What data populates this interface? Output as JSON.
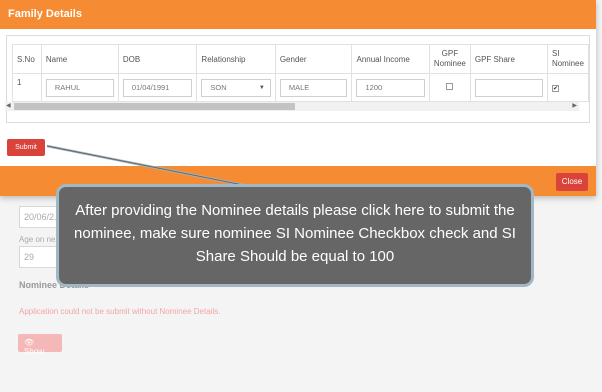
{
  "background": {
    "date_value": "20/06/2...",
    "age_label": "Age on ne...",
    "age_value": "29",
    "nominee_heading": "Nominee Details",
    "error_text": "Application could not be submit without Nominee Details.",
    "show_button": "Show"
  },
  "modal": {
    "title": "Family Details",
    "columns": [
      "S.No",
      "Name",
      "DOB",
      "Relationship",
      "Gender",
      "Annual Income",
      "GPF Nominee",
      "GPF Share",
      "SI Nominee"
    ],
    "row": {
      "sno": "1",
      "name": "RAHUL",
      "dob": "01/04/1991",
      "relationship": "SON",
      "gender": "MALE",
      "annual_income": "1200",
      "gpf_nominee_checked": false,
      "gpf_share": "",
      "si_nominee_checked": true
    },
    "submit_label": "Submit",
    "close_label": "Close"
  },
  "callout": {
    "text": "After providing the Nominee details please click here to submit the nominee, make sure nominee SI Nominee Checkbox check and SI Share Should be equal to 100"
  },
  "colors": {
    "header_orange": "#f58b32",
    "button_red": "#d9433a",
    "callout_bg": "#666666",
    "callout_border": "#a1b8c4"
  }
}
